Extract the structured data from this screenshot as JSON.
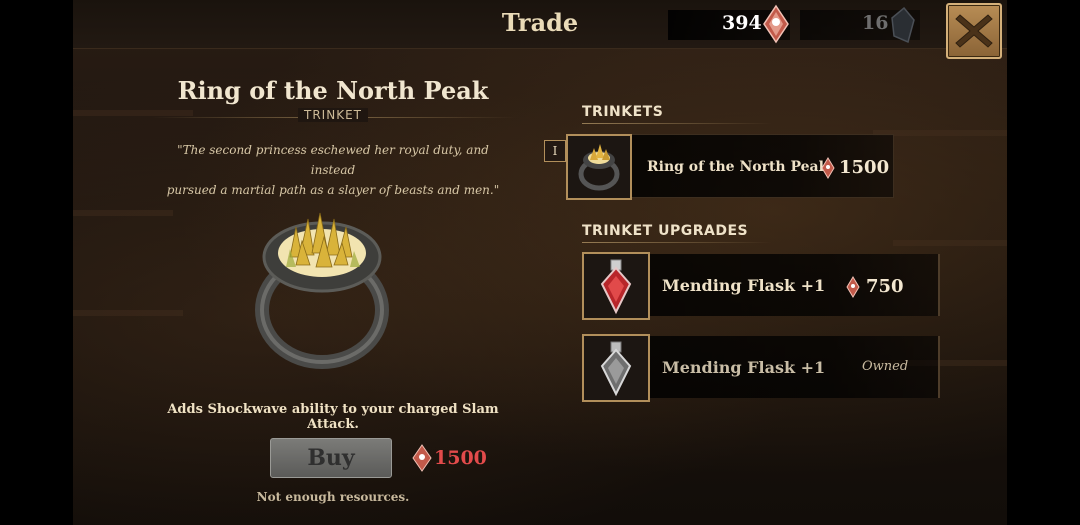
{
  "header": {
    "title": "Trade",
    "primary_currency": "394",
    "secondary_currency": "16",
    "close_label": ""
  },
  "detail": {
    "name": "Ring of the North Peak",
    "type": "TRINKET",
    "flavor_line1": "\"The second princess eschewed her royal duty, and instead",
    "flavor_line2": "pursued a martial path as a slayer of beasts and men.\"",
    "ability": "Adds Shockwave ability to your charged Slam Attack.",
    "buy_label": "Buy",
    "price": "1500",
    "price_color": "#e24b4b",
    "status": "Not enough resources."
  },
  "shop": {
    "trinkets_title": "TRINKETS",
    "tier_label": "I",
    "trinkets": [
      {
        "name": "Ring of the North Peak",
        "price": "1500",
        "icon": "ring-icon"
      }
    ],
    "upgrades_title": "TRINKET UPGRADES",
    "upgrades": [
      {
        "name": "Mending Flask +1",
        "price": "750",
        "icon": "red-flask-icon"
      },
      {
        "name": "Mending Flask +1",
        "owned": "Owned",
        "icon": "grey-flask-icon"
      }
    ]
  },
  "colors": {
    "accent_gold": "#b28f5b",
    "text_light": "#efe2c8",
    "insufficient_red": "#e24b4b"
  }
}
